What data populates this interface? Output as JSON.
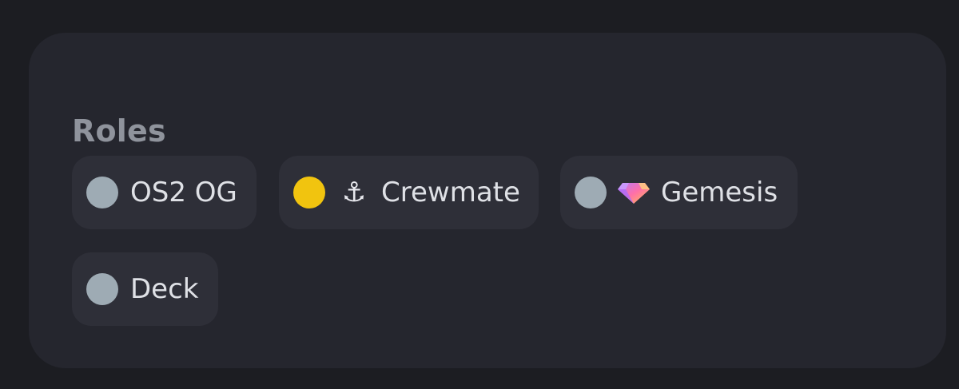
{
  "roles_section": {
    "title": "Roles",
    "roles": [
      {
        "name": "OS2 OG",
        "color": "#9eabb4",
        "emoji": ""
      },
      {
        "name": "Crewmate",
        "color": "#f1c40f",
        "emoji": "anchor-icon",
        "emoji_glyph": "⚓"
      },
      {
        "name": "Gemesis",
        "color": "#9eabb4",
        "emoji": "gem-icon"
      },
      {
        "name": "Deck",
        "color": "#9eabb4",
        "emoji": ""
      }
    ]
  }
}
